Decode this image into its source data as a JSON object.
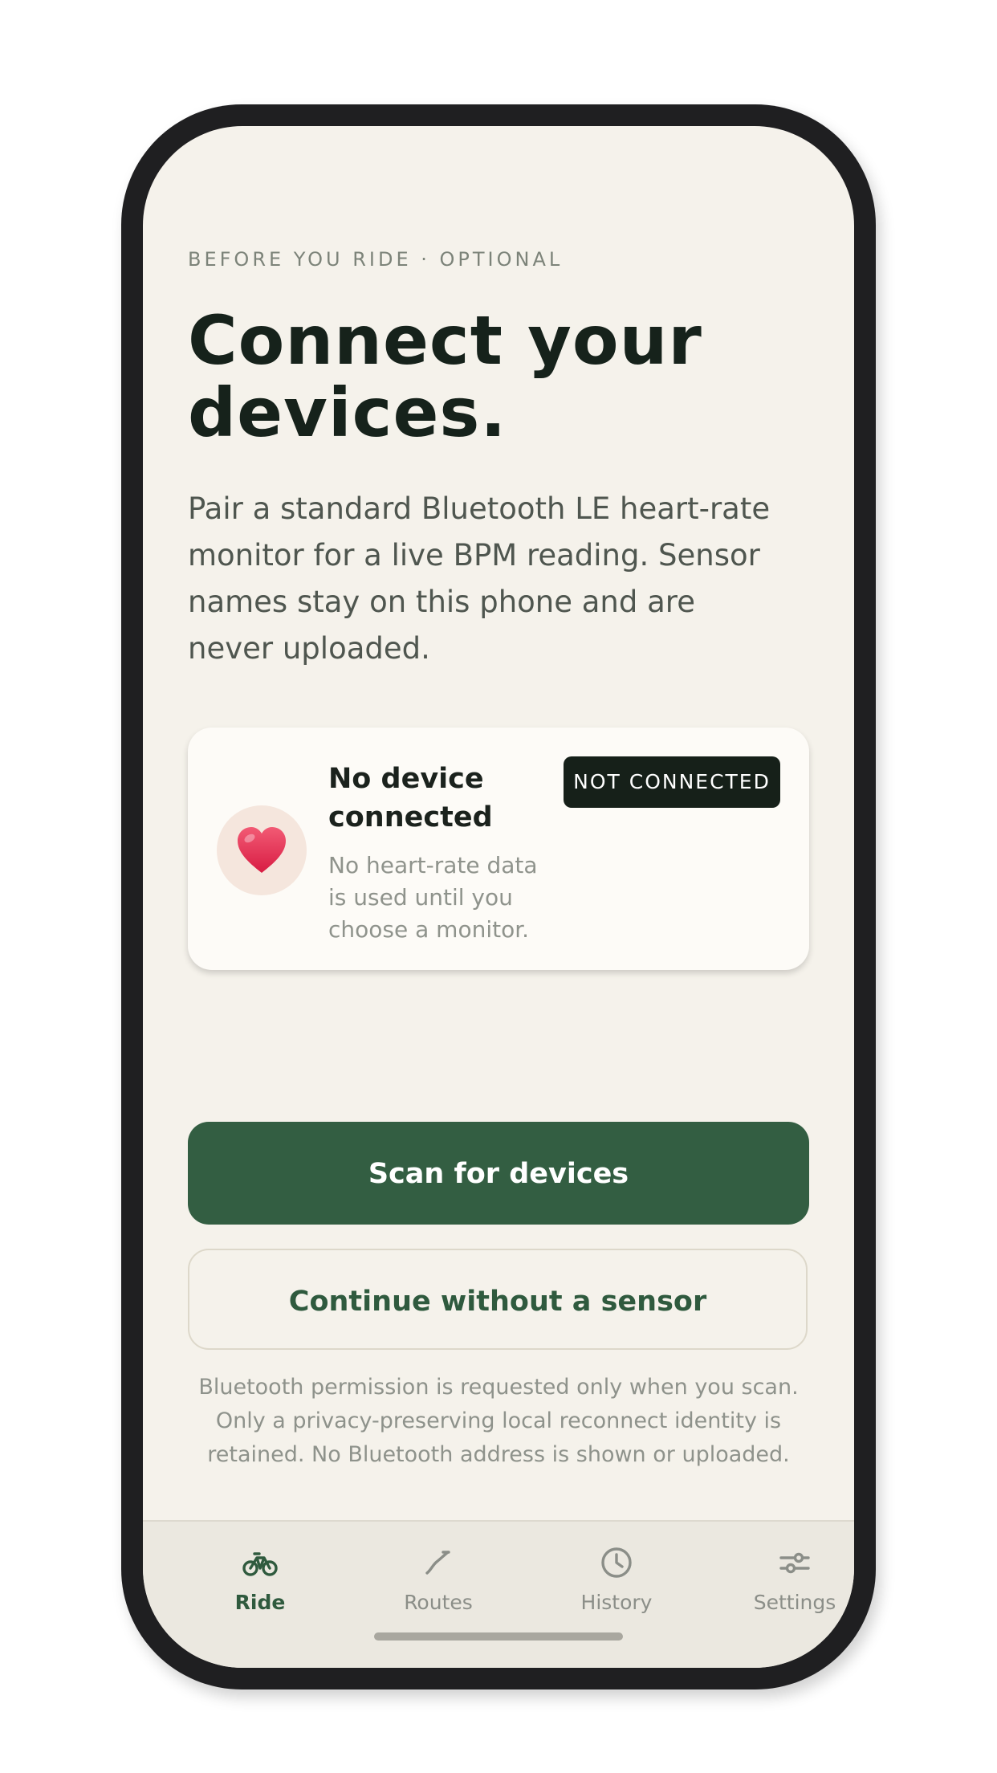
{
  "header": {
    "eyebrow": "BEFORE YOU RIDE · OPTIONAL",
    "title": "Connect your devices.",
    "description": "Pair a standard Bluetooth LE heart-rate monitor for a live BPM reading. Sensor names stay on this phone and are never uploaded."
  },
  "device_card": {
    "icon": "heart-icon",
    "title": "No device connected",
    "subtitle": "No heart-rate data is used until you choose a monitor.",
    "status_badge": "NOT CONNECTED"
  },
  "actions": {
    "scan_label": "Scan for devices",
    "continue_label": "Continue without a sensor"
  },
  "footnote": "Bluetooth permission is requested only when you scan. Only a privacy-preserving local reconnect identity is retained. No Bluetooth address is shown or uploaded.",
  "tabbar": {
    "items": [
      {
        "label": "Ride",
        "icon": "bike-icon",
        "active": true
      },
      {
        "label": "Routes",
        "icon": "route-icon",
        "active": false
      },
      {
        "label": "History",
        "icon": "clock-icon",
        "active": false
      },
      {
        "label": "Settings",
        "icon": "sliders-icon",
        "active": false
      }
    ]
  },
  "colors": {
    "background": "#f5f2eb",
    "accent_green": "#335e42",
    "badge_dark": "#162019",
    "heart_red": "#e0284a"
  }
}
